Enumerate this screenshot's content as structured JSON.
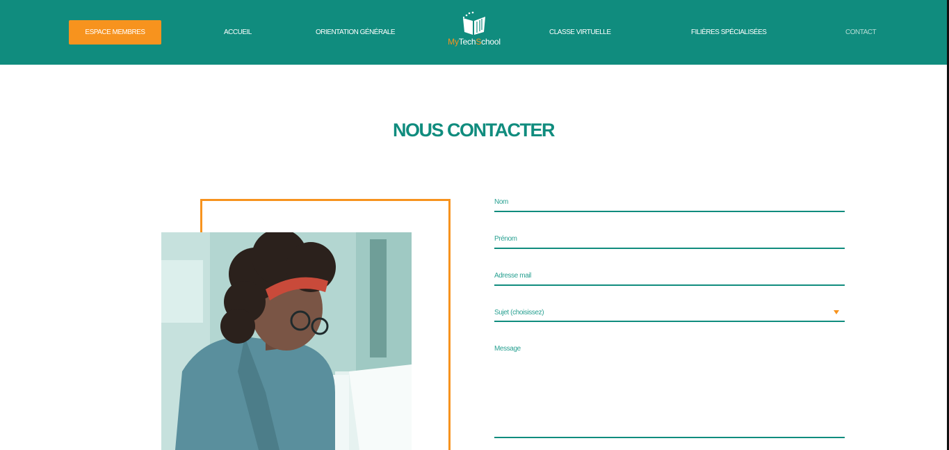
{
  "header": {
    "members_button": "ESPACE MEMBRES",
    "nav": {
      "accueil": "ACCUEIL",
      "orientation": "ORIENTATION GÉNÉRALE",
      "classe": "CLASSE VIRTUELLE",
      "filieres": "FILIÈRES SPÉCIALISÉES",
      "contact": "CONTACT"
    },
    "active_item": "contact",
    "logo": {
      "part1": "My",
      "part2": "Tech",
      "part3": "S",
      "part4": "chool"
    }
  },
  "main": {
    "title": "NOUS CONTACTER",
    "photo_icon": "student-with-laptop-photo"
  },
  "form": {
    "nom_label": "Nom",
    "prenom_label": "Prénom",
    "email_label": "Adresse mail",
    "sujet_label": "Sujet (choisissez)",
    "message_label": "Message"
  },
  "colors": {
    "primary": "#108c7e",
    "accent": "#f7931e",
    "field_text": "#2aa192",
    "active_nav": "#b6ddd6"
  }
}
